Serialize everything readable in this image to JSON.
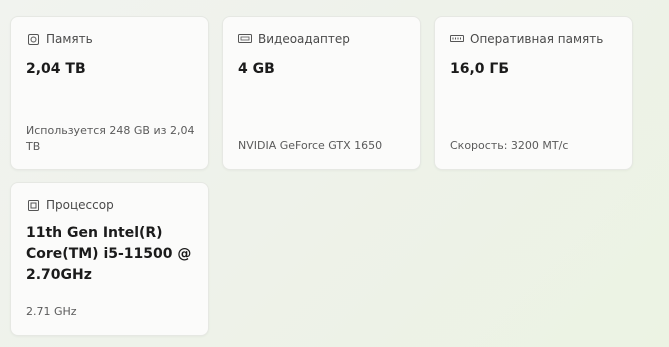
{
  "cards": {
    "storage": {
      "icon": "storage-icon",
      "title": "Память",
      "value": "2,04 TB",
      "detail": "Используется 248 GB из 2,04 TB"
    },
    "gpu": {
      "icon": "display-adapter-icon",
      "title": "Видеоадаптер",
      "value": "4 GB",
      "detail": "NVIDIA GeForce GTX 1650"
    },
    "ram": {
      "icon": "ram-icon",
      "title": "Оперативная память",
      "value": "16,0 ГБ",
      "detail": "Скорость: 3200 MT/c"
    },
    "cpu": {
      "icon": "processor-icon",
      "title": "Процессор",
      "value": "11th Gen Intel(R) Core(TM) i5-11500 @ 2.70GHz",
      "detail": "2.71 GHz"
    }
  }
}
